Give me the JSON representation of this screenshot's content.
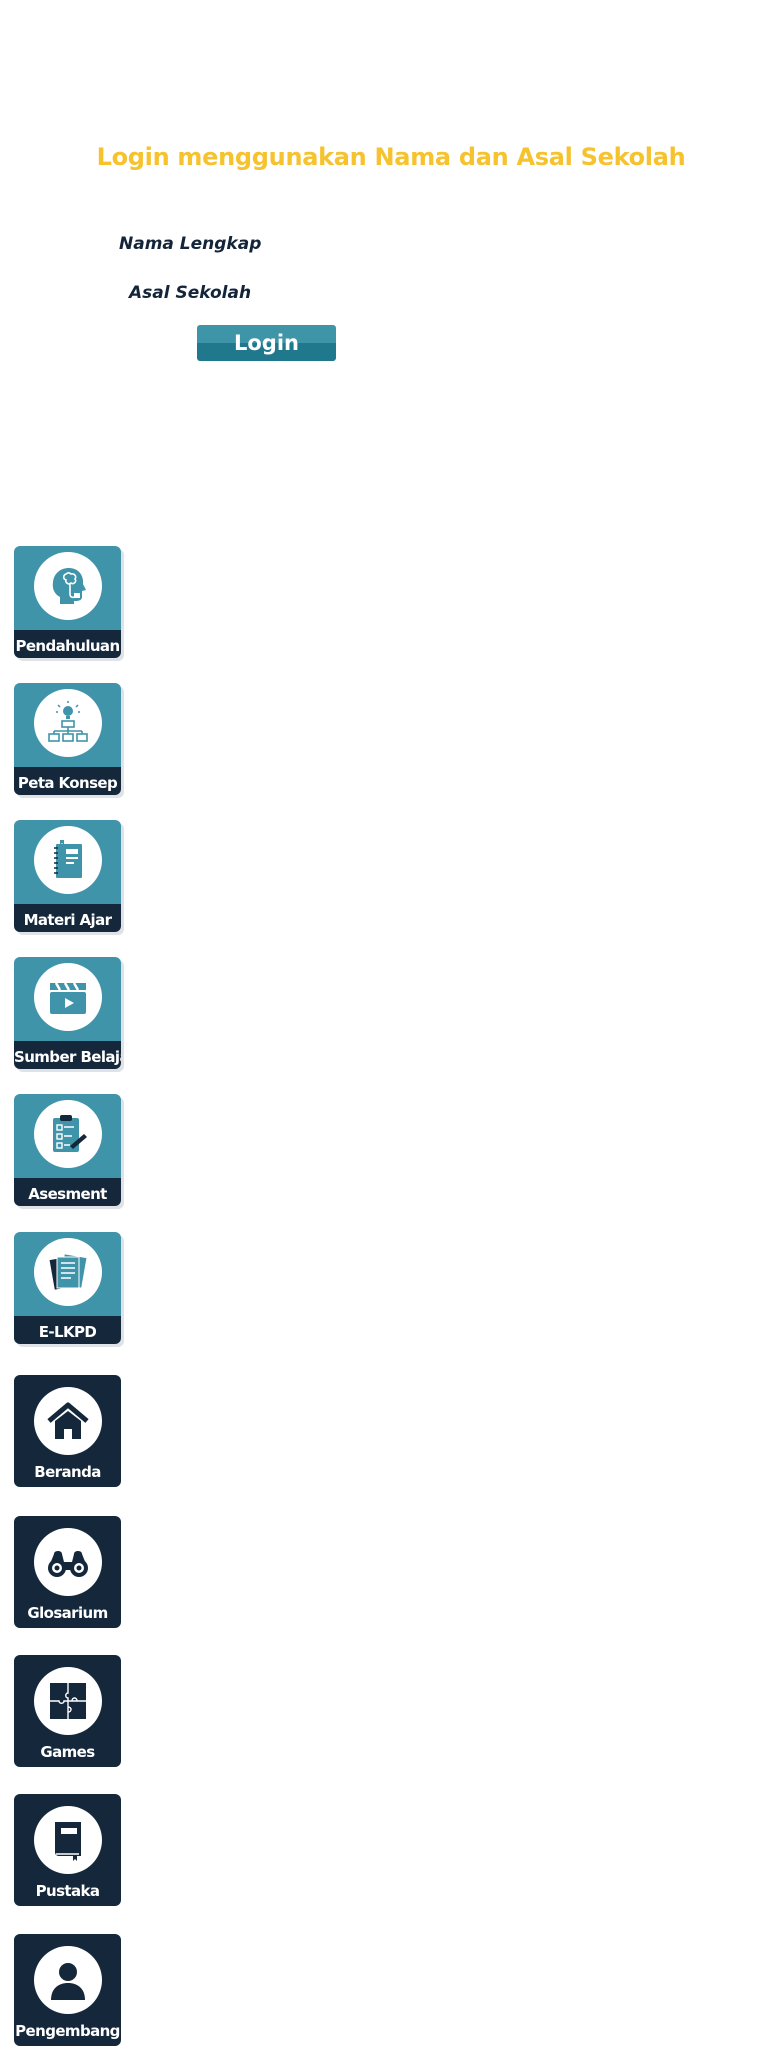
{
  "login": {
    "title": "Login menggunakan Nama dan Asal Sekolah",
    "name_label": "Nama Lengkap",
    "school_label": "Asal Sekolah",
    "name_value": "",
    "school_value": "",
    "button_label": "Login"
  },
  "menu": {
    "items": [
      {
        "label": "Pendahuluan",
        "icon": "head-brain-icon"
      },
      {
        "label": "Peta Konsep",
        "icon": "concept-map-icon"
      },
      {
        "label": "Materi Ajar",
        "icon": "notebook-icon"
      },
      {
        "label": "Sumber Belajar",
        "icon": "video-clapper-icon"
      },
      {
        "label": "Asesment",
        "icon": "clipboard-checklist-icon"
      },
      {
        "label": "E-LKPD",
        "icon": "documents-icon"
      }
    ]
  },
  "nav": {
    "items": [
      {
        "label": "Beranda",
        "icon": "home-icon"
      },
      {
        "label": "Glosarium",
        "icon": "binoculars-icon"
      },
      {
        "label": "Games",
        "icon": "puzzle-icon"
      },
      {
        "label": "Pustaka",
        "icon": "book-icon"
      },
      {
        "label": "Pengembang",
        "icon": "user-icon"
      }
    ]
  },
  "colors": {
    "title": "#f6c22e",
    "tile_teal": "#3f94a9",
    "tile_dark": "#14273b",
    "button_top": "#3f95a8",
    "button_bottom": "#20788d"
  }
}
